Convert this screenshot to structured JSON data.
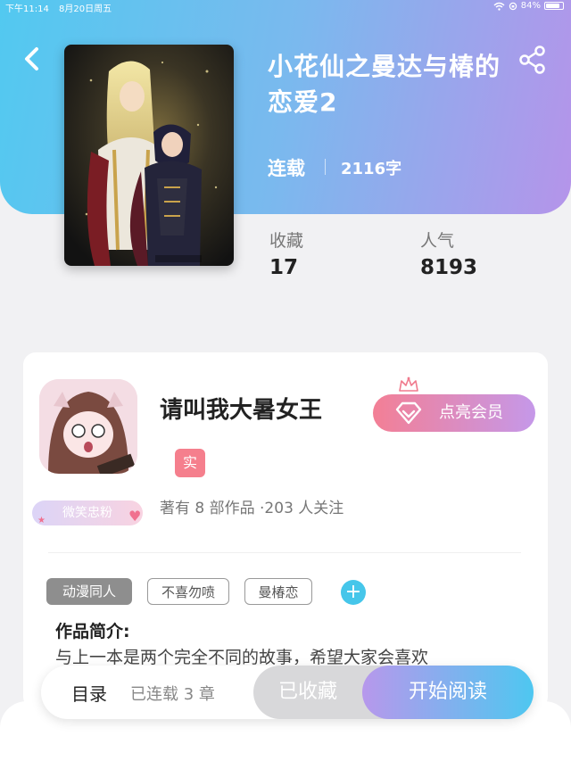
{
  "status_bar": {
    "time": "下午11:14",
    "date": "8月20日周五",
    "battery_text": "84%",
    "battery_level": 0.84
  },
  "book": {
    "title": "小花仙之曼达与椿的恋爱2",
    "status": "连载",
    "words": "2116字",
    "stats": [
      {
        "label": "收藏",
        "value": "17"
      },
      {
        "label": "人气",
        "value": "8193"
      }
    ]
  },
  "author": {
    "name": "请叫我大暑女王",
    "verified_label": "实",
    "fan_badge": "微笑忠粉",
    "stats": "著有 8 部作品 ·203 人关注",
    "vip_button": "点亮会员"
  },
  "tags": [
    {
      "label": "动漫同人",
      "style": "filled"
    },
    {
      "label": "不喜勿喷",
      "style": "outline"
    },
    {
      "label": "曼椿恋",
      "style": "outline"
    }
  ],
  "add_tag_label": "+",
  "intro": {
    "title": "作品简介:",
    "text": "与上一本是两个完全不同的故事，希望大家会喜欢"
  },
  "bottom_bar": {
    "toc_label": "目录",
    "chapter_count": "已连载 3 章",
    "collect_label": "已收藏",
    "read_label": "开始阅读"
  },
  "colors": {
    "header_gradient": [
      "#52c9f0",
      "#b594ea"
    ],
    "vip_gradient": [
      "#f37f95",
      "#c598e9"
    ],
    "read_gradient": [
      "#b798ec",
      "#4ec7f0"
    ],
    "accent_blue": "#46c6ea",
    "verified_red": "#f57f8d"
  },
  "icons": [
    "back-arrow",
    "share",
    "diamond",
    "crown",
    "plus",
    "wifi",
    "battery"
  ]
}
